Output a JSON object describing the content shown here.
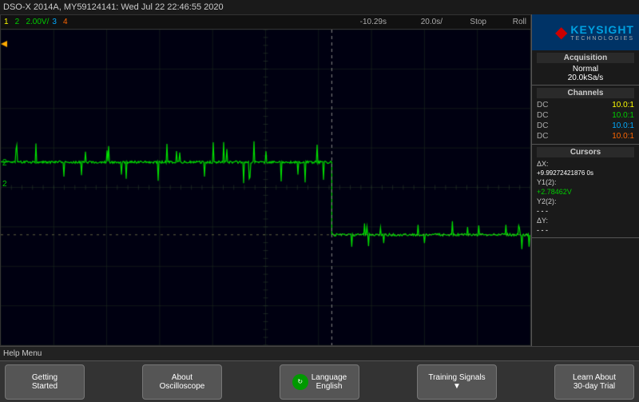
{
  "title_bar": {
    "text": "DSO-X 2014A, MY59124141: Wed Jul 22 22:46:55 2020"
  },
  "scale_bar": {
    "ch1": "1",
    "ch2_label": "2",
    "ch2_scale": "2.00V/",
    "ch3": "3",
    "ch4": "4",
    "time_offset": "-10.29s",
    "timebase": "20.0s/",
    "status": "Stop",
    "mode": "Roll"
  },
  "right_panel": {
    "logo": {
      "brand": "KEYSIGHT",
      "sub": "TECHNOLOGIES"
    },
    "acquisition": {
      "title": "Acquisition",
      "mode": "Normal",
      "sample_rate": "20.0kSa/s"
    },
    "channels": {
      "title": "Channels",
      "rows": [
        {
          "coupling": "DC",
          "value": "10.0:1"
        },
        {
          "coupling": "DC",
          "value": "10.0:1"
        },
        {
          "coupling": "DC",
          "value": "10.0:1"
        },
        {
          "coupling": "DC",
          "value": "10.0:1"
        }
      ]
    },
    "cursors": {
      "title": "Cursors",
      "delta_x_label": "ΔX:",
      "delta_x_value": "+9.99272421876 0s",
      "y1_label": "Y1(2):",
      "y1_value": "+2.78462V",
      "y2_label": "Y2(2):",
      "y2_value": "- - -",
      "delta_y_label": "ΔY:",
      "delta_y_value": "- - -"
    }
  },
  "help_menu": {
    "label": "Help Menu"
  },
  "bottom_buttons": [
    {
      "id": "getting-started",
      "line1": "Getting",
      "line2": "Started"
    },
    {
      "id": "about-oscilloscope",
      "line1": "About",
      "line2": "Oscilloscope"
    },
    {
      "id": "language",
      "line1": "Language",
      "line2": "English",
      "has_icon": true
    },
    {
      "id": "training-signals",
      "line1": "Training Signals",
      "line2": "▼"
    },
    {
      "id": "learn-about",
      "line1": "Learn About",
      "line2": "30-day Trial"
    }
  ],
  "waveform": {
    "ch2_marker": "2",
    "cursor_x_position": 0.63,
    "signal_level_high": 0.45,
    "signal_level_low": 0.65
  }
}
